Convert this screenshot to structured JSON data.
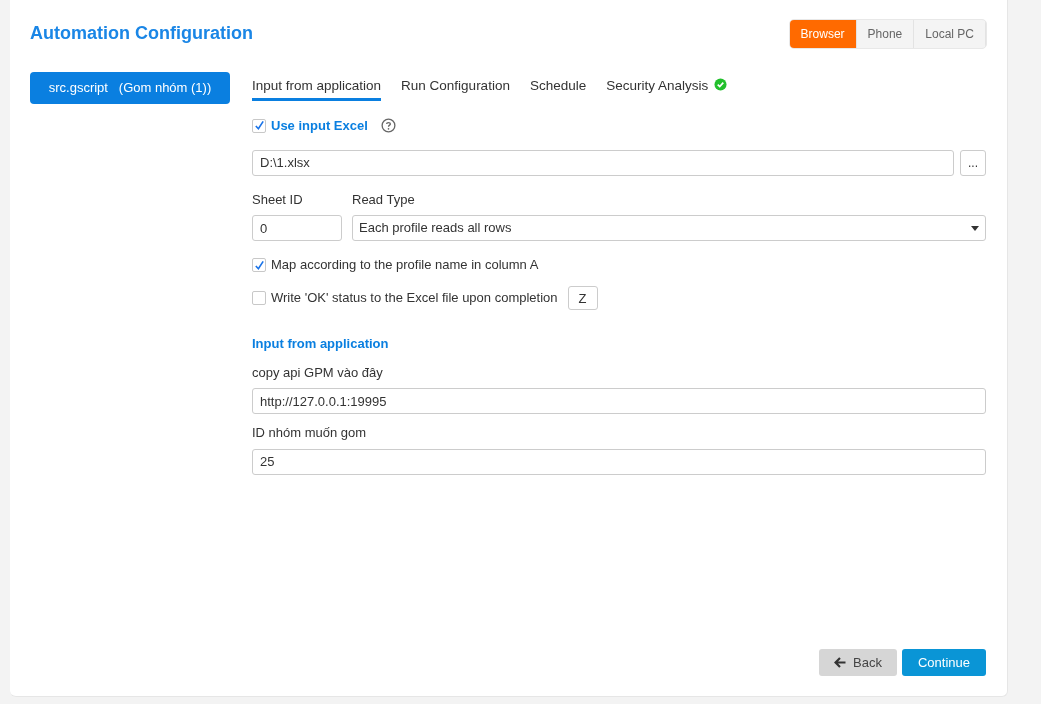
{
  "title": "Automation Configuration",
  "modes": [
    {
      "label": "Browser",
      "selected": true
    },
    {
      "label": "Phone",
      "selected": false
    },
    {
      "label": "Local PC",
      "selected": false
    }
  ],
  "script_button": "src.gscript   (Gom nhóm (1))",
  "tabs": [
    {
      "label": "Input from application",
      "selected": true,
      "verified": false
    },
    {
      "label": "Run Configuration",
      "selected": false,
      "verified": false
    },
    {
      "label": "Schedule",
      "selected": false,
      "verified": false
    },
    {
      "label": "Security Analysis",
      "selected": false,
      "verified": true
    }
  ],
  "use_excel": {
    "label": "Use input Excel",
    "checked": true
  },
  "file_path": {
    "value": "D:\\1.xlsx",
    "browse": "..."
  },
  "sheet_id": {
    "label": "Sheet ID",
    "value": "0"
  },
  "read_type": {
    "label": "Read Type",
    "value": "Each profile reads all rows"
  },
  "options": [
    {
      "label": "Map according to the profile name in column A",
      "checked": true
    },
    {
      "label": "Write 'OK' status to the Excel file upon completion",
      "checked": false,
      "column": "Z"
    }
  ],
  "section_title": "Input from application",
  "fields": [
    {
      "label": "copy api GPM vào đây",
      "value": "http://127.0.0.1:19995"
    },
    {
      "label": "ID nhóm muốn gom",
      "value": "25"
    }
  ],
  "buttons": {
    "back": "Back",
    "continue": "Continue"
  }
}
